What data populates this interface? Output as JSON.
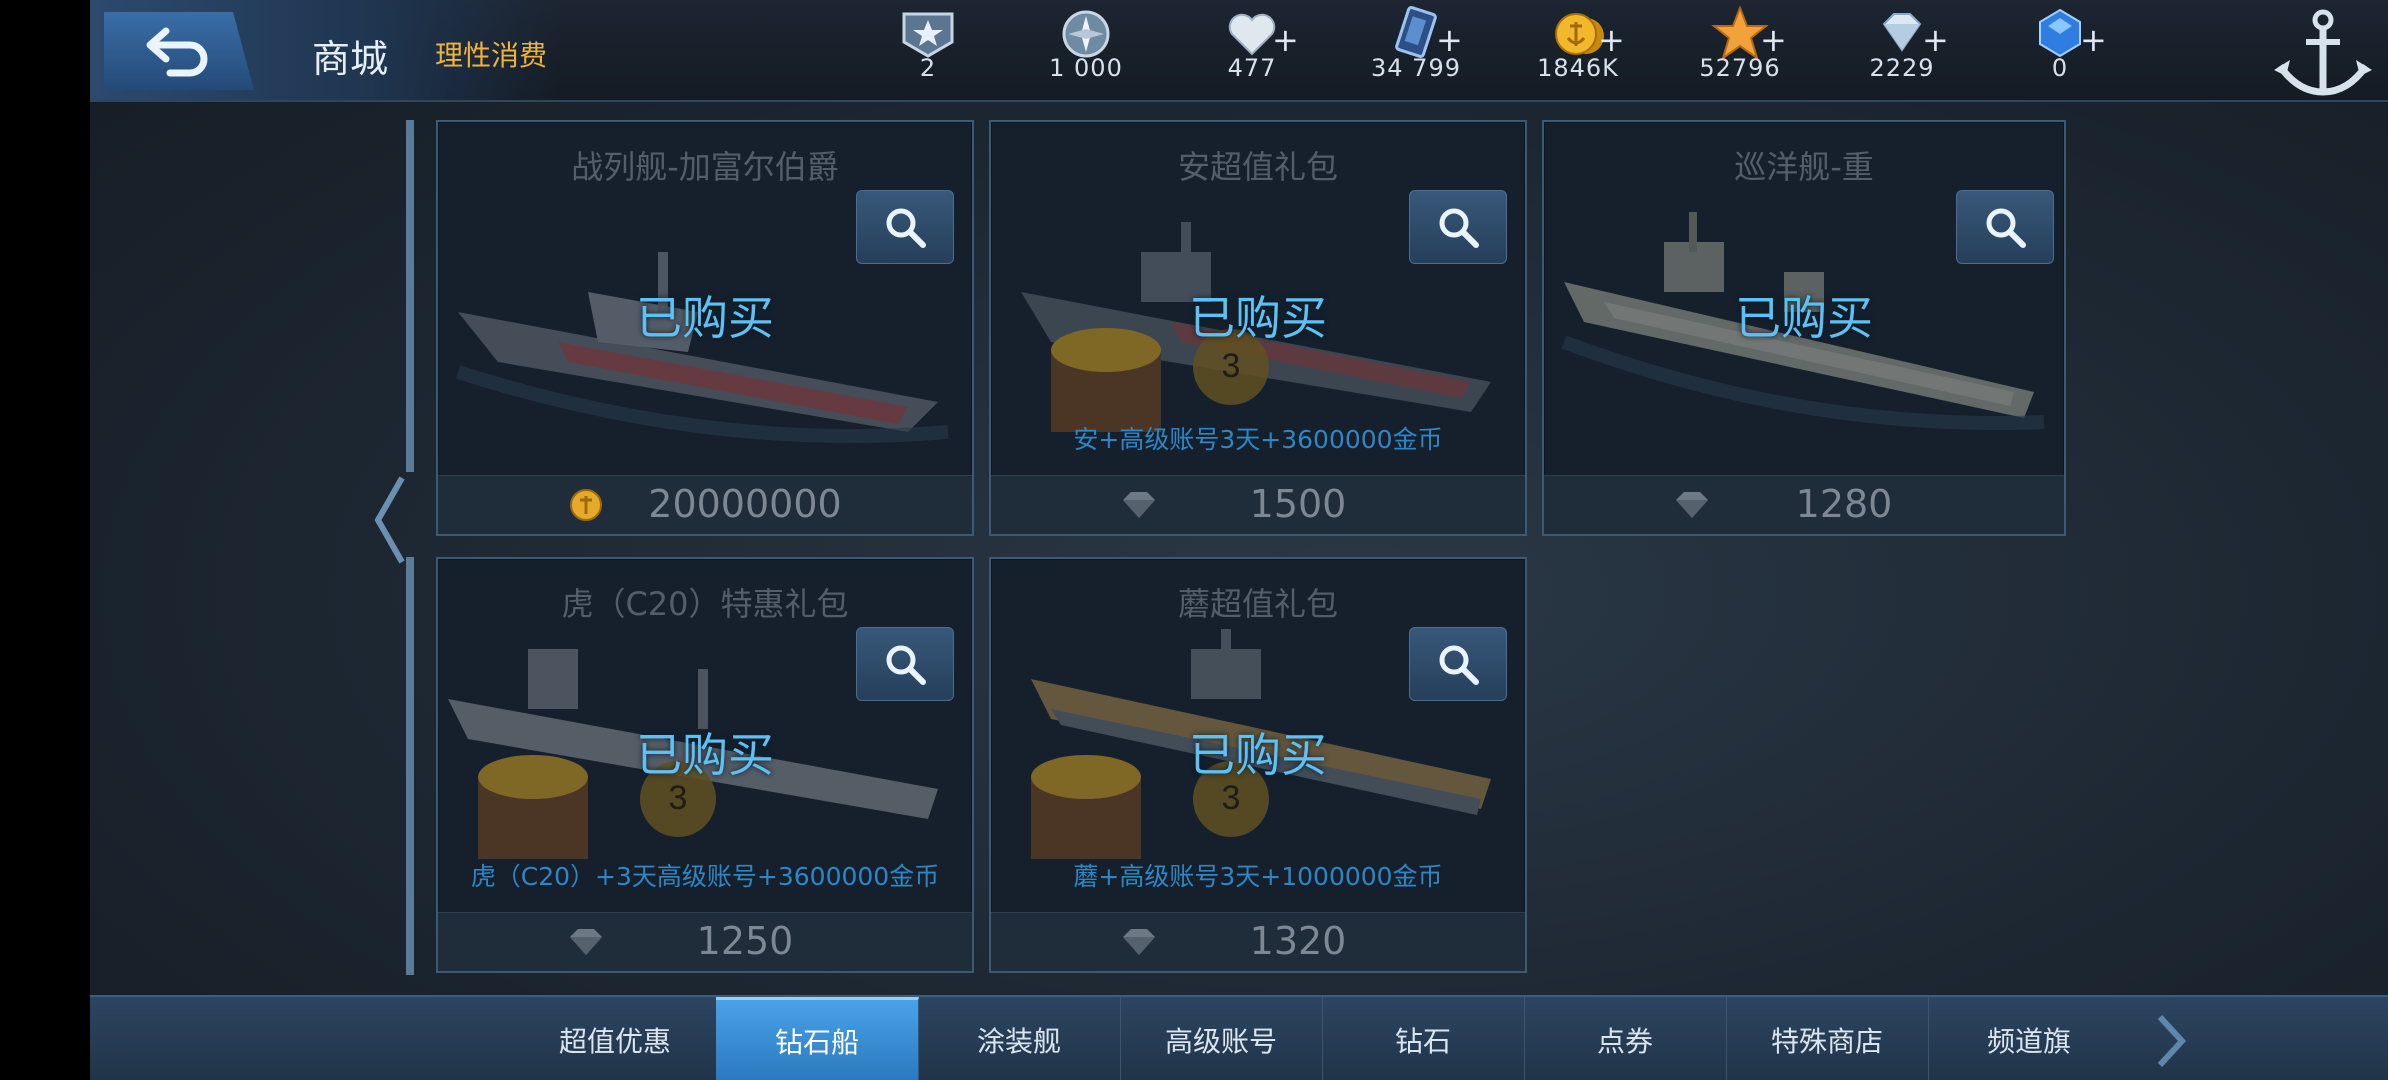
{
  "header": {
    "title": "商城",
    "subtitle": "理性消费"
  },
  "currencies": [
    {
      "name": "rank-badge",
      "value": "2",
      "has_plus": false
    },
    {
      "name": "compass-points",
      "value": "1 000",
      "has_plus": false
    },
    {
      "name": "heart",
      "value": "477",
      "has_plus": true
    },
    {
      "name": "card",
      "value": "34 799",
      "has_plus": true
    },
    {
      "name": "gold-coin",
      "value": "1846K",
      "has_plus": true
    },
    {
      "name": "star",
      "value": "52796",
      "has_plus": true
    },
    {
      "name": "diamond",
      "value": "2229",
      "has_plus": true
    },
    {
      "name": "blue-gem",
      "value": "0",
      "has_plus": true
    }
  ],
  "cards": [
    {
      "title": "战列舰-加富尔伯爵",
      "status": "已购买",
      "desc": "",
      "price": "20000000",
      "price_icon": "gold-coin-icon",
      "ship": "battleship-striped"
    },
    {
      "title": "安超值礼包",
      "status": "已购买",
      "desc": "安+高级账号3天+3600000金币",
      "price": "1500",
      "price_icon": "diamond-icon",
      "ship": "destroyer-striped-chest"
    },
    {
      "title": "巡洋舰-重",
      "status": "已购买",
      "desc": "",
      "price": "1280",
      "price_icon": "diamond-icon",
      "ship": "cruiser-white"
    },
    {
      "title": "虎（C20）特惠礼包",
      "status": "已购买",
      "desc": "虎（C20）+3天高级账号+3600000金币",
      "price": "1250",
      "price_icon": "diamond-icon",
      "ship": "cruiser-grey-chest"
    },
    {
      "title": "蘑超值礼包",
      "status": "已购买",
      "desc": "蘑+高级账号3天+1000000金币",
      "price": "1320",
      "price_icon": "diamond-icon",
      "ship": "cruiser-tan-chest"
    }
  ],
  "tabs": [
    {
      "label": "超值优惠",
      "active": false
    },
    {
      "label": "钻石船",
      "active": true
    },
    {
      "label": "涂装舰",
      "active": false
    },
    {
      "label": "高级账号",
      "active": false
    },
    {
      "label": "钻石",
      "active": false
    },
    {
      "label": "点券",
      "active": false
    },
    {
      "label": "特殊商店",
      "active": false
    },
    {
      "label": "频道旗",
      "active": false
    }
  ],
  "colors": {
    "accent": "#4aa3e6",
    "subtitle": "#f0b33a",
    "purchased_text": "#5fc0f2"
  }
}
